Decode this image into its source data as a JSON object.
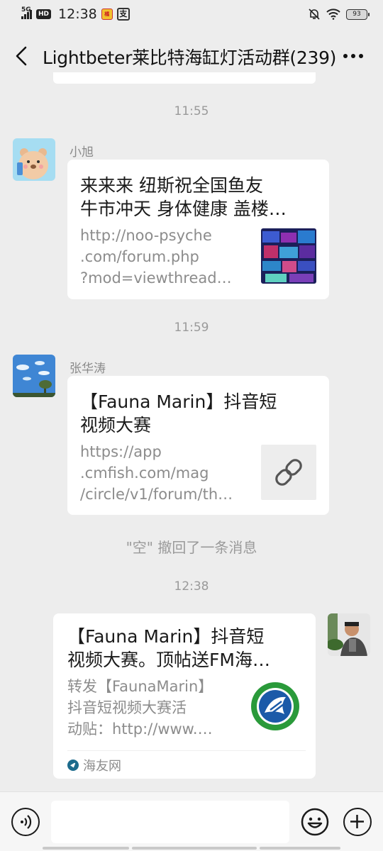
{
  "status_bar": {
    "network": "5G",
    "hd": "HD",
    "time": "12:38",
    "app1_label": "橘",
    "app2_label": "支",
    "battery": "93"
  },
  "header": {
    "title": "Lightbeter莱比特海缸灯活动群(239)"
  },
  "messages": [
    {
      "time": "11:55",
      "sender": "小旭",
      "title_lines": [
        "来来来 纽斯祝全国鱼友",
        "牛市冲天 身体健康 盖楼…"
      ],
      "desc_lines": [
        "http://noo-psyche",
        ".com/forum.php",
        "?mod=viewthread…"
      ]
    },
    {
      "time": "11:59",
      "sender": "张华涛",
      "title_lines": [
        "【Fauna Marin】抖音短",
        "视频大赛"
      ],
      "desc_lines": [
        "https://app",
        ".cmfish.com/mag",
        "/circle/v1/forum/th…"
      ],
      "thumb_icon": "link-icon"
    },
    {
      "system": "\"空\" 撤回了一条消息"
    },
    {
      "time": "12:38",
      "title_lines": [
        "【Fauna Marin】抖音短",
        "视频大赛。顶帖送FM海…"
      ],
      "desc_lines": [
        "转发【FaunaMarin】",
        "抖音短视频大赛活",
        "动贴：http://www.…"
      ],
      "source": "海友网"
    }
  ],
  "colors": {
    "background": "#ededed",
    "card": "#ffffff",
    "meta_text": "#9a9a9a",
    "logo_green": "#2a9a3a",
    "logo_blue": "#1b5aa8"
  },
  "input_bar": {
    "placeholder": ""
  }
}
